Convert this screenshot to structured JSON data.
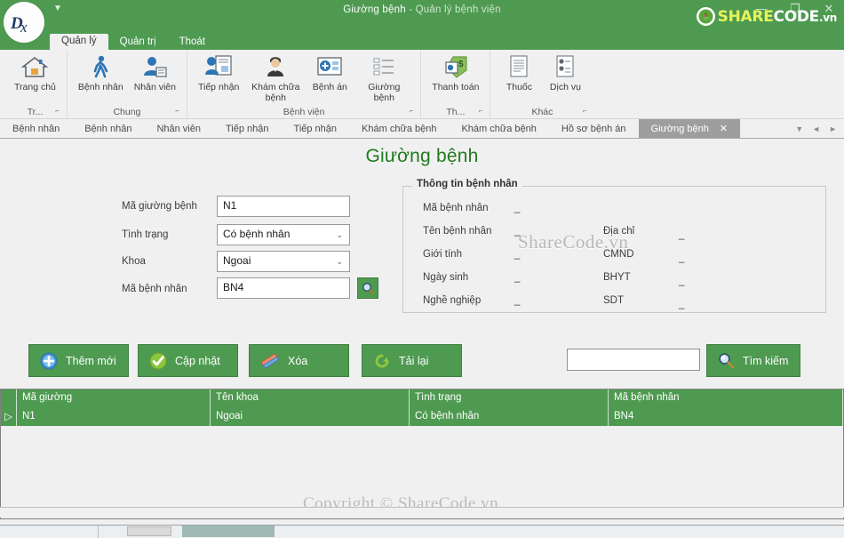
{
  "window": {
    "title_main": "Giường bệnh",
    "title_sub": " - Quản lý bệnh viện",
    "minimize": "—",
    "maximize": "❐",
    "close": "✕",
    "quick_access_icon": "quick-access-toolbar-icon",
    "logo_text": "Dx",
    "brand": {
      "share": "SHARE",
      "code": "CODE",
      "vn": ".vn"
    },
    "accent_green": "#4E9A51",
    "title_green": "#1F7A1F"
  },
  "ribbon": {
    "tabs": [
      {
        "label": "Quản lý",
        "active": true
      },
      {
        "label": "Quản trị",
        "active": false
      },
      {
        "label": "Thoát",
        "active": false
      }
    ],
    "groups": [
      {
        "name": "Tr...",
        "dialog_launcher": "⌐",
        "items": [
          {
            "label": "Trang chủ",
            "icon": "home-icon"
          }
        ]
      },
      {
        "name": "Chung",
        "dialog_launcher": "⌐",
        "items": [
          {
            "label": "Bệnh nhân",
            "icon": "walking-person-icon"
          },
          {
            "label": "Nhân viên",
            "icon": "employee-card-icon"
          }
        ]
      },
      {
        "name": "Bệnh viện",
        "dialog_launcher": "⌐",
        "items": [
          {
            "label": "Tiếp nhận",
            "icon": "reception-form-icon"
          },
          {
            "label": "Khám chữa bệnh",
            "icon": "doctor-icon"
          },
          {
            "label": "Bệnh án",
            "icon": "add-record-icon"
          },
          {
            "label": "Giường bệnh",
            "icon": "list-icon"
          }
        ]
      },
      {
        "name": "Th...",
        "dialog_launcher": "⌐",
        "items": [
          {
            "label": "Thanh toán",
            "icon": "payment-tag-icon"
          }
        ]
      },
      {
        "name": "Khác",
        "dialog_launcher": "⌐",
        "items": [
          {
            "label": "Thuốc",
            "icon": "document-lines-icon"
          },
          {
            "label": "Dịch vụ",
            "icon": "service-list-icon"
          }
        ]
      }
    ]
  },
  "doc_tabs": {
    "items": [
      {
        "label": "Bệnh nhân",
        "active": false
      },
      {
        "label": "Bệnh nhân",
        "active": false
      },
      {
        "label": "Nhân viên",
        "active": false
      },
      {
        "label": "Tiếp nhận",
        "active": false
      },
      {
        "label": "Tiếp nhận",
        "active": false
      },
      {
        "label": "Khám chữa bệnh",
        "active": false
      },
      {
        "label": "Khám chữa bệnh",
        "active": false
      },
      {
        "label": "Hồ sơ bệnh án",
        "active": false
      },
      {
        "label": "Giường bệnh",
        "active": true,
        "close": "✕"
      }
    ],
    "nav": {
      "dropdown": "▼",
      "prev": "◄",
      "next": "►"
    }
  },
  "page": {
    "title": "Giường bệnh",
    "fields": [
      {
        "label": "Mã giường bệnh",
        "value": "N1",
        "type": "text"
      },
      {
        "label": "Tình trạng",
        "value": "Có bệnh nhân",
        "type": "combo"
      },
      {
        "label": "Khoa",
        "value": "Ngoai",
        "type": "combo"
      },
      {
        "label": "Mã bệnh nhân",
        "value": "BN4",
        "type": "text"
      }
    ],
    "lookup_button_icon": "magnifier-icon",
    "combo_arrow": "⌄"
  },
  "patient_info": {
    "title": "Thông tin bệnh nhân",
    "left_rows": [
      {
        "label": "Mã bệnh nhân",
        "value": "_"
      },
      {
        "label": "Tên bệnh nhân",
        "value": "_"
      },
      {
        "label": "Giới tính",
        "value": "_"
      },
      {
        "label": "Ngày sinh",
        "value": "_"
      },
      {
        "label": "Nghề nghiệp",
        "value": "_"
      }
    ],
    "right_rows": [
      {
        "label": "Địa chỉ",
        "value": "_"
      },
      {
        "label": "CMND",
        "value": "_"
      },
      {
        "label": "BHYT",
        "value": "_"
      },
      {
        "label": "SDT",
        "value": "_"
      }
    ]
  },
  "actions": [
    {
      "label": "Thêm mới",
      "icon": "plus-circle-icon"
    },
    {
      "label": "Cập nhật",
      "icon": "check-circle-icon"
    },
    {
      "label": "Xóa",
      "icon": "eraser-icon"
    },
    {
      "label": "Tải lại",
      "icon": "refresh-icon"
    }
  ],
  "search": {
    "value": "",
    "placeholder": "",
    "button_label": "Tìm kiếm",
    "button_icon": "magnifier-icon"
  },
  "grid": {
    "columns": [
      "Mã giường",
      "Tên khoa",
      "Tình trạng",
      "Mã bệnh nhân"
    ],
    "row_selector": "▷",
    "rows": [
      {
        "cells": [
          "N1",
          "Ngoai",
          "Có bệnh nhân",
          "BN4"
        ],
        "selected": true
      }
    ]
  },
  "watermarks": {
    "center": "ShareCode.vn",
    "bottom": "Copyright © ShareCode.vn"
  }
}
